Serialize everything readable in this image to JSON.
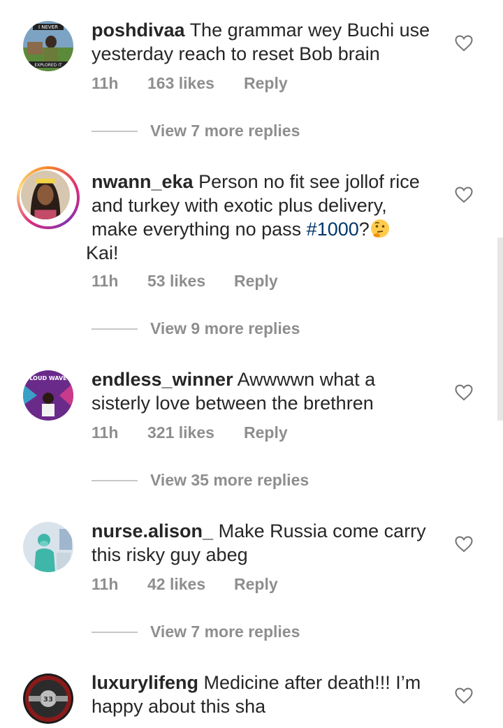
{
  "comments": [
    {
      "username": "poshdivaa",
      "text": "The grammar wey Buchi use yesterday reach to reset Bob brain",
      "time": "11h",
      "likes": "163 likes",
      "reply": "Reply",
      "view_more": "View 7 more replies",
      "avatar_caption_top": "I NEVER",
      "avatar_caption_bottom": "EXPLORED IT"
    },
    {
      "username": "nwann_eka",
      "text_before": "Person no fit see jollof rice and turkey with exotic plus delivery, make everything no pass ",
      "hashtag": "#1000",
      "text_after": "?",
      "text_end": " Kai!",
      "time": "11h",
      "likes": "53 likes",
      "reply": "Reply",
      "view_more": "View 9 more replies"
    },
    {
      "username": "endless_winner",
      "text": "Awwwwn what a sisterly love between the brethren",
      "time": "11h",
      "likes": "321 likes",
      "reply": "Reply",
      "view_more": "View 35 more replies",
      "avatar_caption_top": "LOUD WAVE"
    },
    {
      "username": "nurse.alison_",
      "text": "Make Russia come carry this risky guy abeg",
      "time": "11h",
      "likes": "42 likes",
      "reply": "Reply",
      "view_more": "View 7 more replies"
    },
    {
      "username": "luxurylifeng",
      "text": "Medicine after death!!! I’m happy about this sha",
      "avatar_badge": "33"
    }
  ],
  "icons": {
    "like": "heart-outline-icon",
    "emoji": "thinking-face-emoji"
  },
  "colors": {
    "text": "#262626",
    "meta": "#8e8e8e",
    "hashtag": "#00376b"
  }
}
